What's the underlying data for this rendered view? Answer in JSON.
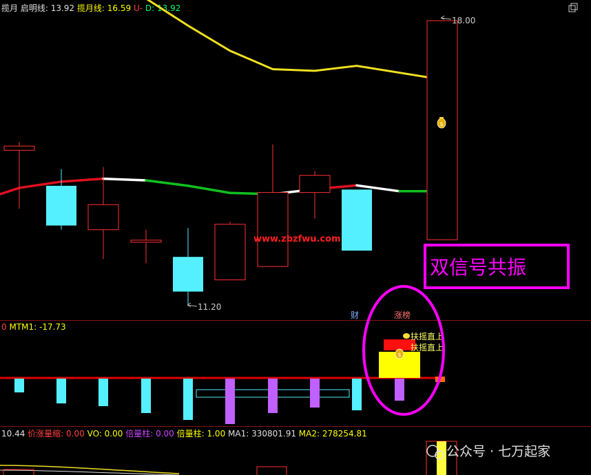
{
  "header_top": {
    "items": [
      {
        "label": "揽月",
        "value": "",
        "color": "#e0e0e0"
      },
      {
        "label": "启明线",
        "value": ": 13.92",
        "color": "#e0e0e0"
      },
      {
        "label": "揽月线",
        "value": ": 16.59",
        "color": "#ffff00"
      },
      {
        "label": "U",
        "value": "-",
        "color": "#ff4040"
      },
      {
        "label": "D",
        "value": ": 13.92",
        "color": "#00ff66"
      }
    ]
  },
  "header_mid": {
    "items": [
      {
        "label": "0",
        "value": "",
        "color": "#ff4040"
      },
      {
        "label": "MTM1",
        "value": ": -17.73",
        "color": "#ffff00"
      }
    ]
  },
  "header_bottom": {
    "items": [
      {
        "label": "",
        "value": "10.44",
        "color": "#e0e0e0"
      },
      {
        "label": "价涨量缩",
        "value": ": 0.00",
        "color": "#ff4040"
      },
      {
        "label": "VO",
        "value": ": 0.00",
        "color": "#ffff00"
      },
      {
        "label": "倍量柱",
        "value": ": 0.00",
        "color": "#cc44ff"
      },
      {
        "label": "倍量柱",
        "value": ": 1.00",
        "color": "#ffff00"
      },
      {
        "label": "MA1",
        "value": ": 330801.91",
        "color": "#e0e0e0"
      },
      {
        "label": "MA2",
        "value": ": 278254.81",
        "color": "#ffff00"
      }
    ]
  },
  "annotations": {
    "price_high": "18.00",
    "price_low": "11.20",
    "watermark": "www.zbzfwu.com",
    "callout": "双信号共振",
    "tag_cai": "财",
    "tag_zhangbang": "涨榜",
    "signal_1": "扶摇直上",
    "signal_2": "扶摇直上",
    "footer_brand": "公众号 · 七万起家"
  },
  "colors": {
    "up": "#ff3030",
    "down": "#55f0ff",
    "yellow_line": "#f0e020",
    "ma_red": "#e01020",
    "ma_white": "#ffffff",
    "ma_green": "#10c020",
    "purple": "#c060ff",
    "callout": "#ff00ff"
  },
  "chart_data": [
    {
      "type": "candlestick",
      "candles": [
        {
          "open": 14.9,
          "high": 15.1,
          "low": 13.5,
          "close": 15.0
        },
        {
          "open": 14.05,
          "high": 14.45,
          "low": 13.0,
          "close": 13.1
        },
        {
          "open": 13.0,
          "high": 14.5,
          "low": 12.3,
          "close": 13.6
        },
        {
          "open": 12.75,
          "high": 13.0,
          "low": 12.2,
          "close": 12.75
        },
        {
          "open": 12.35,
          "high": 13.04,
          "low": 11.2,
          "close": 11.52
        },
        {
          "open": 11.8,
          "high": 13.19,
          "low": 11.8,
          "close": 13.13
        },
        {
          "open": 12.12,
          "high": 15.04,
          "low": 12.12,
          "close": 13.89
        },
        {
          "open": 13.89,
          "high": 14.4,
          "low": 13.27,
          "close": 14.3
        },
        {
          "open": 13.96,
          "high": 13.96,
          "low": 12.5,
          "close": 12.5
        },
        {
          "open": 12.76,
          "high": 18.0,
          "low": 12.76,
          "close": 18.0
        }
      ],
      "series": [
        {
          "name": "揽月线",
          "values": [
            null,
            null,
            null,
            null,
            17.88,
            17.28,
            16.84,
            16.8,
            16.92,
            16.59
          ]
        },
        {
          "name": "启明线",
          "values": [
            14.0,
            14.15,
            14.22,
            14.18,
            14.05,
            13.88,
            13.85,
            13.97,
            14.06,
            13.92
          ]
        }
      ]
    },
    {
      "type": "bar",
      "series": [
        {
          "name": "MTM1",
          "values": [
            -1.0,
            -1.8,
            -2.0,
            -2.5,
            -3.0,
            -3.3,
            -2.5,
            -2.1,
            -2.3,
            -1.6
          ]
        }
      ]
    }
  ]
}
